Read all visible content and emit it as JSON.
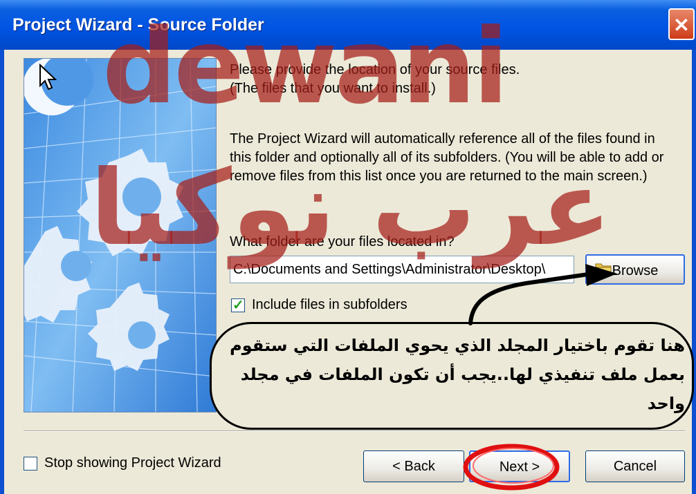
{
  "window": {
    "title": "Project Wizard - Source Folder",
    "close_glyph": "✕"
  },
  "intro": {
    "line1": "Please provide the location of your source files.",
    "line2": "(The files that you want to install.)",
    "desc1": "The Project Wizard will automatically reference all of the files found in",
    "desc2": "this folder and optionally all of its subfolders. (You will be able to add or",
    "desc3": "remove files from this list once you are returned to the main screen.)"
  },
  "folder": {
    "question": "What folder are your files located in?",
    "path_value": "C:\\Documents and Settings\\Administrator\\Desktop\\",
    "browse_label": "Browse",
    "include_subfolders_label": "Include files in subfolders",
    "include_subfolders_checked": true
  },
  "footer": {
    "stop_showing_label": "Stop showing Project Wizard",
    "stop_showing_checked": false,
    "back_label": "< Back",
    "next_label": "Next >",
    "cancel_label": "Cancel"
  },
  "annotation": {
    "callout_text": "هنا تقوم باختيار المجلد الذي يحوي الملفات التي ستقوم بعمل ملف تنفيذي لها..يجب أن تكون الملفات في مجلد واحد",
    "watermark_latin": "dewani",
    "watermark_arabic": "عرب نوكيا"
  },
  "colors": {
    "titlebar": "#0054e3",
    "face": "#ece9d8",
    "watermark": "#a51e19",
    "highlight_ring": "#e01010",
    "art_blue": "#4d9de8"
  }
}
